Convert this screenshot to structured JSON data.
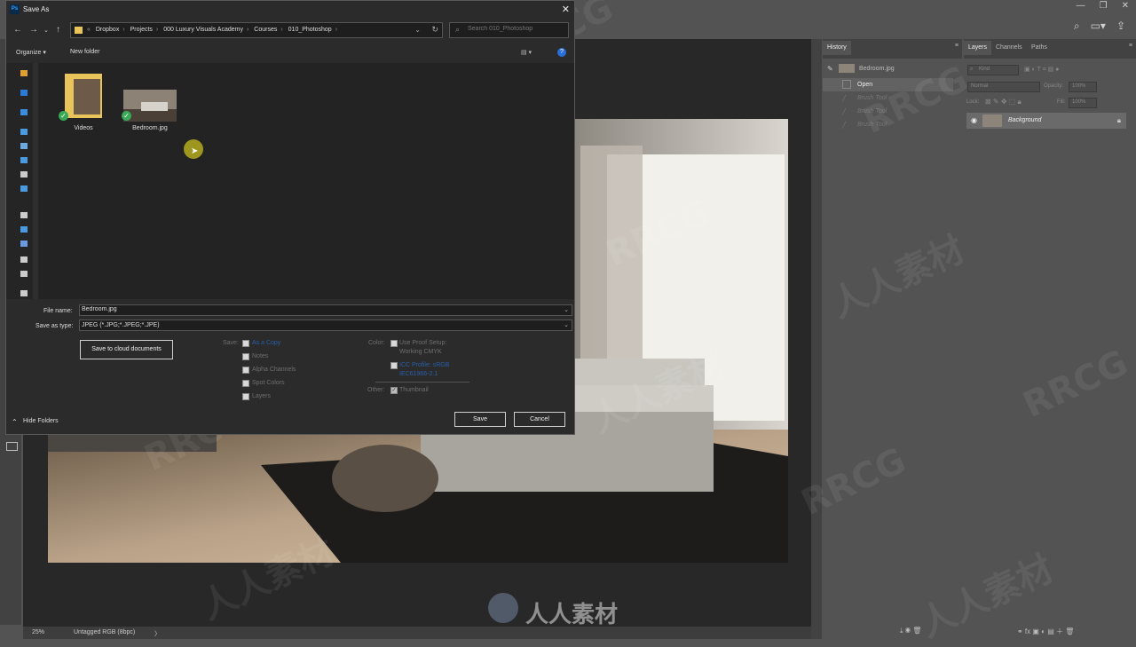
{
  "dialog": {
    "title": "Save As",
    "breadcrumb": [
      "«",
      "Dropbox",
      "Projects",
      "000 Luxury Visuals Academy",
      "Courses",
      "010_Photoshop"
    ],
    "search_placeholder": "Search 010_Photoshop",
    "toolbar": {
      "organize": "Organize ▾",
      "new_folder": "New folder"
    },
    "files": [
      {
        "name": "Videos",
        "type": "folder"
      },
      {
        "name": "Bedroom.jpg",
        "type": "image"
      }
    ],
    "file_name_label": "File name:",
    "file_name_value": "Bedroom.jpg",
    "save_as_type_label": "Save as type:",
    "save_as_type_value": "JPEG (*.JPG;*.JPEG;*.JPE)",
    "cloud_button": "Save to cloud documents",
    "save_section": {
      "label": "Save:",
      "options": [
        "As a Copy",
        "Notes",
        "Alpha Channels",
        "Spot Colors",
        "Layers"
      ]
    },
    "color_section": {
      "label": "Color:",
      "proof_line1": "Use Proof Setup:",
      "proof_line2": "Working CMYK",
      "icc_line1": "ICC Profile: sRGB",
      "icc_line2": "IEC61966-2.1"
    },
    "other_section": {
      "label": "Other:",
      "thumbnail": "Thumbnail"
    },
    "hide_folders": "Hide Folders",
    "save_button": "Save",
    "cancel_button": "Cancel"
  },
  "history": {
    "tab": "History",
    "snapshot": "Bedroom.jpg",
    "steps": [
      "Open",
      "Brush Tool",
      "Brush Tool",
      "Brush Tool"
    ]
  },
  "layers": {
    "tabs": [
      "Layers",
      "Channels",
      "Paths"
    ],
    "kind_placeholder": "Kind",
    "blend_mode": "Normal",
    "opacity_label": "Opacity:",
    "opacity_value": "100%",
    "lock_label": "Lock:",
    "fill_label": "Fill:",
    "fill_value": "100%",
    "layer_name": "Background"
  },
  "status": {
    "zoom": "25%",
    "profile": "Untagged RGB (8bpc)"
  },
  "watermarks": [
    "RRCG",
    "人人素材"
  ],
  "colors": {
    "accent_blue": "#2a5fa8",
    "check_green": "#3aa957"
  }
}
